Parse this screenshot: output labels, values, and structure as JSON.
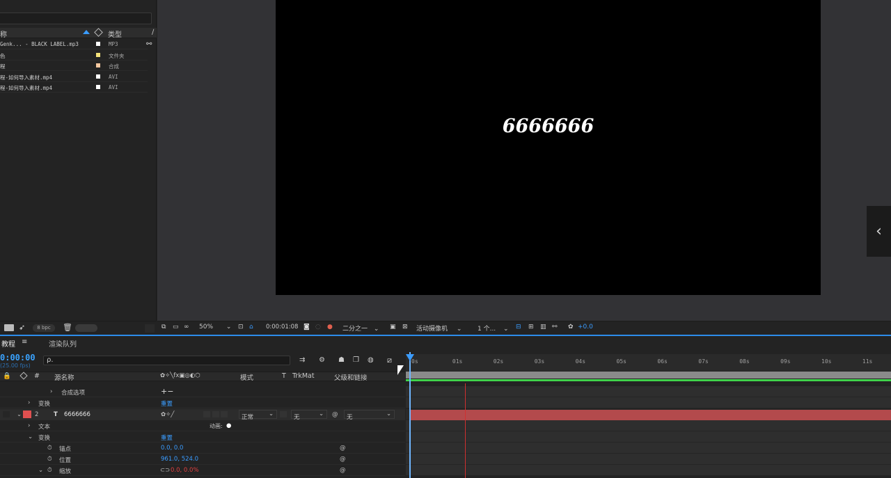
{
  "project": {
    "header": {
      "name_col": "称",
      "type_col": "类型"
    },
    "items": [
      {
        "name": "Genk... - BLACK LABEL.mp3",
        "type": "MP3",
        "color": "#ffffff"
      },
      {
        "name": "色",
        "type": "文件夹",
        "color": "#f4e27a"
      },
      {
        "name": "程",
        "type": "合成",
        "color": "#f5c8a0"
      },
      {
        "name": "程-如何导入素材.mp4",
        "type": "AVI",
        "color": "#ffffff"
      },
      {
        "name": "程-如何导入素材.mp4",
        "type": "AVI",
        "color": "#ffffff"
      }
    ],
    "footer": {
      "bpc": "8 bpc"
    }
  },
  "viewer": {
    "canvas_text": "6666666",
    "zoom": "50%",
    "timecode": "0:00:01:08",
    "resolution": "二分之一",
    "camera": "活动摄像机",
    "views": "1 个...",
    "exposure": "+0.0"
  },
  "timeline": {
    "tabs": {
      "comp": "教程",
      "render_queue": "渲染队列"
    },
    "time": "0:00:00",
    "fps": "(25.00 fps)",
    "search_placeholder": "ρ.",
    "columns": {
      "hash": "#",
      "source_name": "源名称",
      "mode": "模式",
      "t": "T",
      "trkmat": "TrkMat",
      "parent": "父级和链接"
    },
    "rows": {
      "comp_options": "合成选项",
      "transform": "变换",
      "reset": "重置",
      "layer_num": "2",
      "layer_name": "6666666",
      "mode": "正常",
      "trkmat": "无",
      "parent": "无",
      "text": "文本",
      "animate": "动画:",
      "transform2": "变换",
      "reset2": "重置",
      "anchor": "锚点",
      "anchor_val": "0.0, 0.0",
      "position": "位置",
      "position_val": "961.0, 524.0",
      "scale": "缩放",
      "scale_val": "0.0, 0.0%"
    },
    "ruler": [
      "0s",
      "01s",
      "02s",
      "03s",
      "04s",
      "05s",
      "06s",
      "07s",
      "08s",
      "09s",
      "10s",
      "11s"
    ]
  }
}
